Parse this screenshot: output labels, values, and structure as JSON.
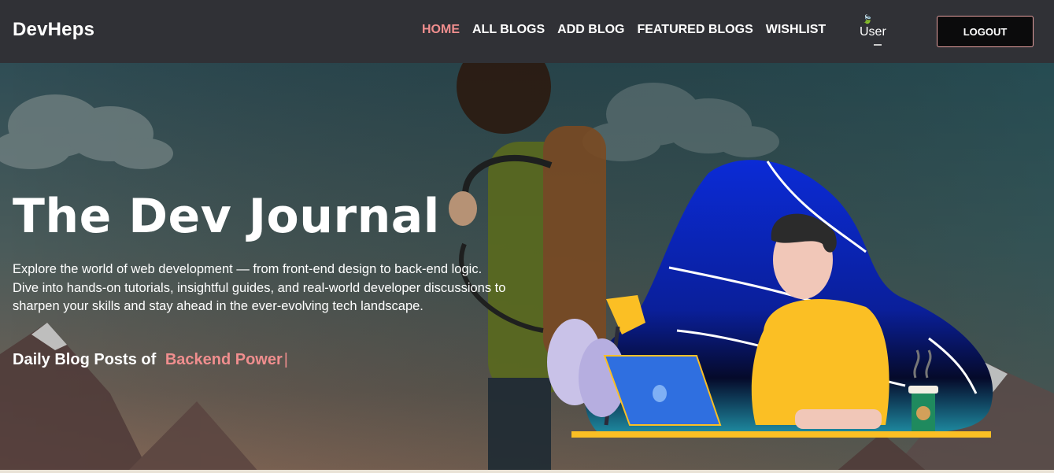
{
  "brand": "DevHeps",
  "nav": {
    "links": [
      {
        "label": "HOME",
        "active": true
      },
      {
        "label": "ALL BLOGS",
        "active": false
      },
      {
        "label": "ADD BLOG",
        "active": false
      },
      {
        "label": "FEATURED BLOGS",
        "active": false
      },
      {
        "label": "WISHLIST",
        "active": false
      }
    ],
    "user_alt": "User",
    "logout_label": "LOGOUT"
  },
  "hero": {
    "title": "The Dev Journal",
    "description": "Explore the world of web development — from front-end design to back-end logic. Dive into hands-on tutorials, insightful guides, and real-world developer discussions to sharpen your skills and stay ahead in the ever-evolving tech landscape.",
    "tagline_prefix": "Daily Blog Posts of",
    "typed_text": "Backend Power",
    "cursor": "|"
  },
  "colors": {
    "accent": "#f08e8e",
    "navbar": "#303136",
    "blob": "#0a2bd1",
    "shirt": "#fbbf24"
  }
}
